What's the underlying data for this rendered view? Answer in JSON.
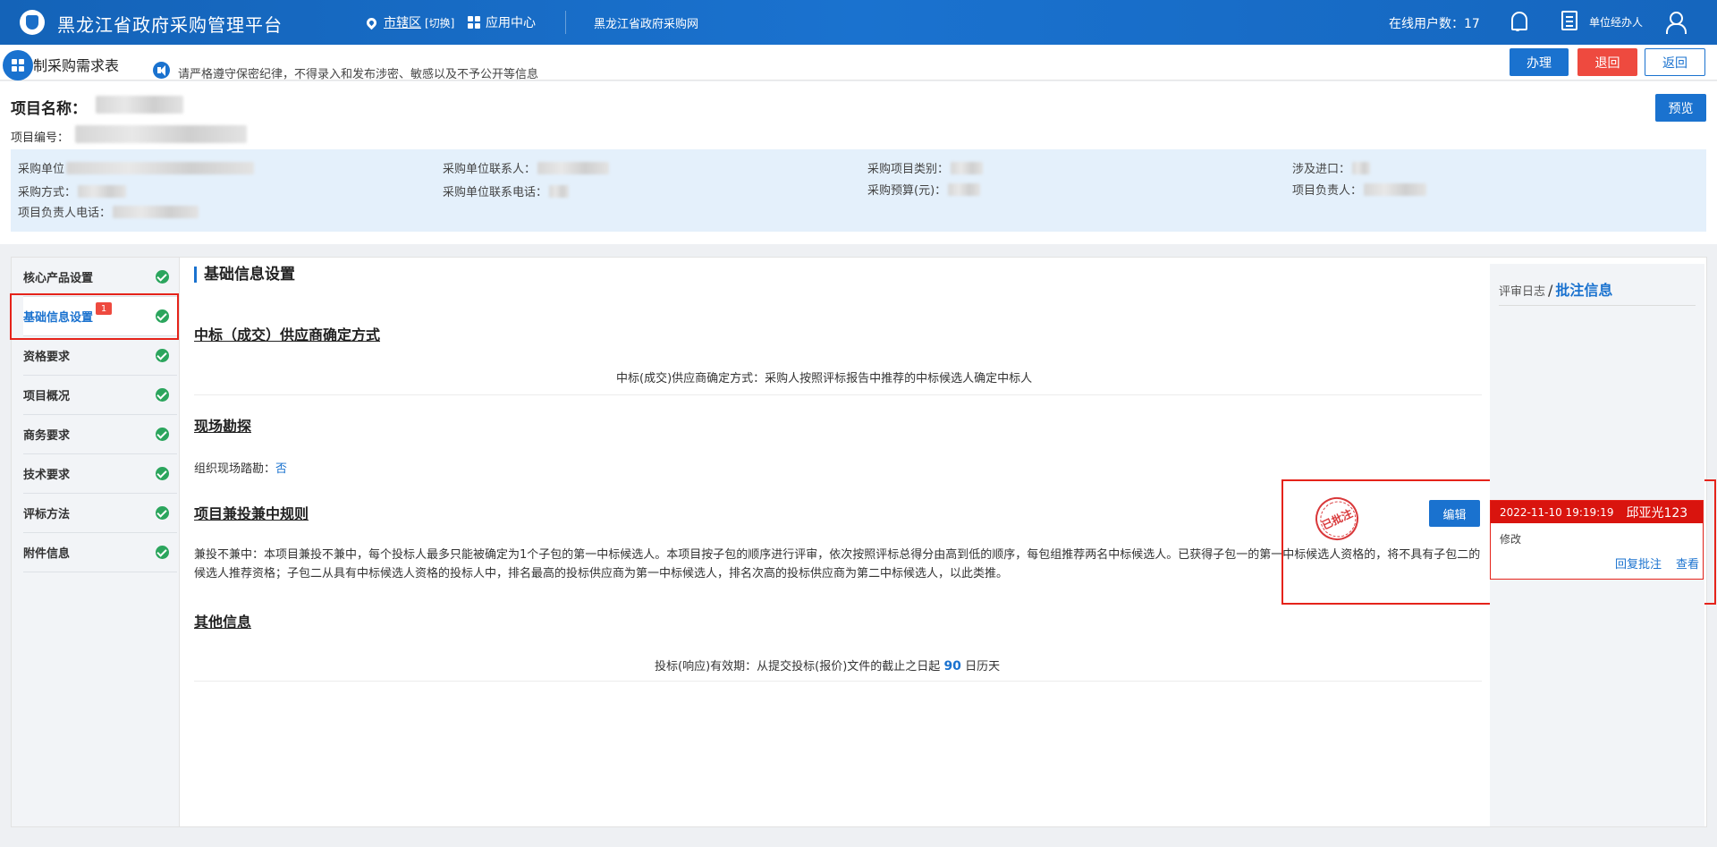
{
  "header": {
    "app_title": "黑龙江省政府采购管理平台",
    "region": "市辖区",
    "switch": "[切换]",
    "app_center": "应用中心",
    "site_link": "黑龙江省政府采购网",
    "online_label": "在线用户数：",
    "online_count": "17",
    "role": "单位经办人"
  },
  "page": {
    "title": "制采购需求表",
    "notice": "请严格遵守保密纪律，不得录入和发布涉密、敏感以及不予公开等信息",
    "actions": {
      "handle": "办理",
      "reject": "退回",
      "back": "返回",
      "preview": "预览"
    }
  },
  "project": {
    "name_label": "项目名称：",
    "no_label": "项目编号：",
    "fields": [
      {
        "label": "采购单位"
      },
      {
        "label": "采购单位联系人："
      },
      {
        "label": "采购项目类别："
      },
      {
        "label": "涉及进口："
      },
      {
        "label": "采购方式："
      },
      {
        "label": "采购单位联系电话："
      },
      {
        "label": "采购预算(元)："
      },
      {
        "label": "项目负责人："
      },
      {
        "label": "项目负责人电话："
      }
    ]
  },
  "sidebar": {
    "items": [
      {
        "label": "核心产品设置"
      },
      {
        "label": "基础信息设置",
        "badge": "1"
      },
      {
        "label": "资格要求"
      },
      {
        "label": "项目概况"
      },
      {
        "label": "商务要求"
      },
      {
        "label": "技术要求"
      },
      {
        "label": "评标方法"
      },
      {
        "label": "附件信息"
      }
    ]
  },
  "main": {
    "section_title": "基础信息设置",
    "award": {
      "title": "中标（成交）供应商确定方式",
      "text": "中标(成交)供应商确定方式：采购人按照评标报告中推荐的中标候选人确定中标人"
    },
    "site_visit": {
      "title": "现场勘探",
      "label": "组织现场踏勘：",
      "value": "否"
    },
    "multi_bid": {
      "title": "项目兼投兼中规则",
      "text": "兼投不兼中：本项目兼投不兼中，每个投标人最多只能被确定为1个子包的第一中标候选人。本项目按子包的顺序进行评审，依次按照评标总得分由高到低的顺序，每包组推荐两名中标候选人。已获得子包一的第一中标候选人资格的，将不具有子包二的候选人推荐资格；子包二从具有中标候选人资格的投标人中，排名最高的投标供应商为第一中标候选人，排名次高的投标供应商为第二中标候选人，以此类推。"
    },
    "other": {
      "title": "其他信息",
      "prefix": "投标(响应)有效期：从提交投标(报价)文件的截止之日起",
      "days": "90",
      "suffix": "日历天"
    },
    "stamp": "已批注",
    "edit": "编辑"
  },
  "review": {
    "log_tab": "评审日志",
    "separator": "/",
    "annotation_tab": "批注信息",
    "card": {
      "time": "2022-11-10 19:19:19",
      "user": "邱亚光123",
      "content": "修改",
      "reply": "回复批注",
      "view": "查看"
    }
  },
  "colors": {
    "primary": "#1a72cf",
    "danger": "#ee4a3f",
    "success": "#2ba55d",
    "highlight_border": "#e5231a"
  }
}
